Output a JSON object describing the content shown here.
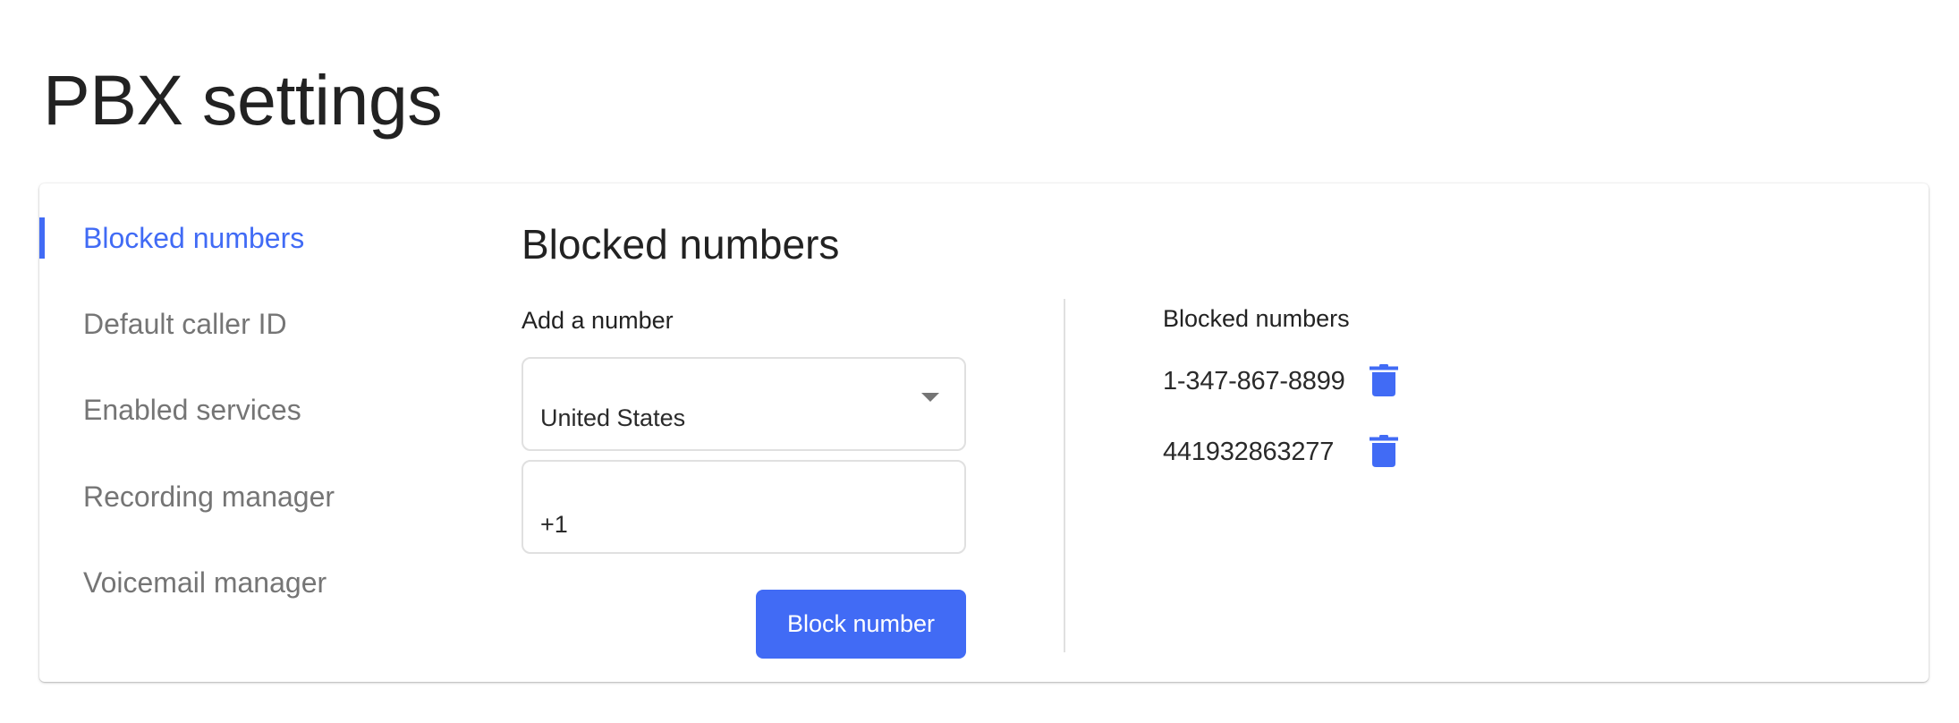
{
  "page": {
    "title": "PBX settings"
  },
  "sidebar": {
    "active_index": 0,
    "items": [
      {
        "label": "Blocked numbers",
        "active": true
      },
      {
        "label": "Default caller ID",
        "active": false
      },
      {
        "label": "Enabled services",
        "active": false
      },
      {
        "label": "Recording manager",
        "active": false
      },
      {
        "label": "Voicemail manager",
        "active": false
      }
    ]
  },
  "main": {
    "section_title": "Blocked numbers",
    "add_form": {
      "label": "Add a number",
      "country_select": {
        "selected": "United States",
        "icon": "arrow-drop-down-icon"
      },
      "phone_input": {
        "value": "+1"
      },
      "submit_label": "Block number"
    },
    "blocked_list": {
      "heading": "Blocked numbers",
      "items": [
        {
          "number": "1-347-867-8899",
          "action_icon": "trash-icon"
        },
        {
          "number": "441932863277",
          "action_icon": "trash-icon"
        }
      ]
    }
  },
  "colors": {
    "accent": "#416BF5",
    "text_primary": "#212121",
    "text_secondary": "#757575",
    "border": "#e0e0e0"
  }
}
